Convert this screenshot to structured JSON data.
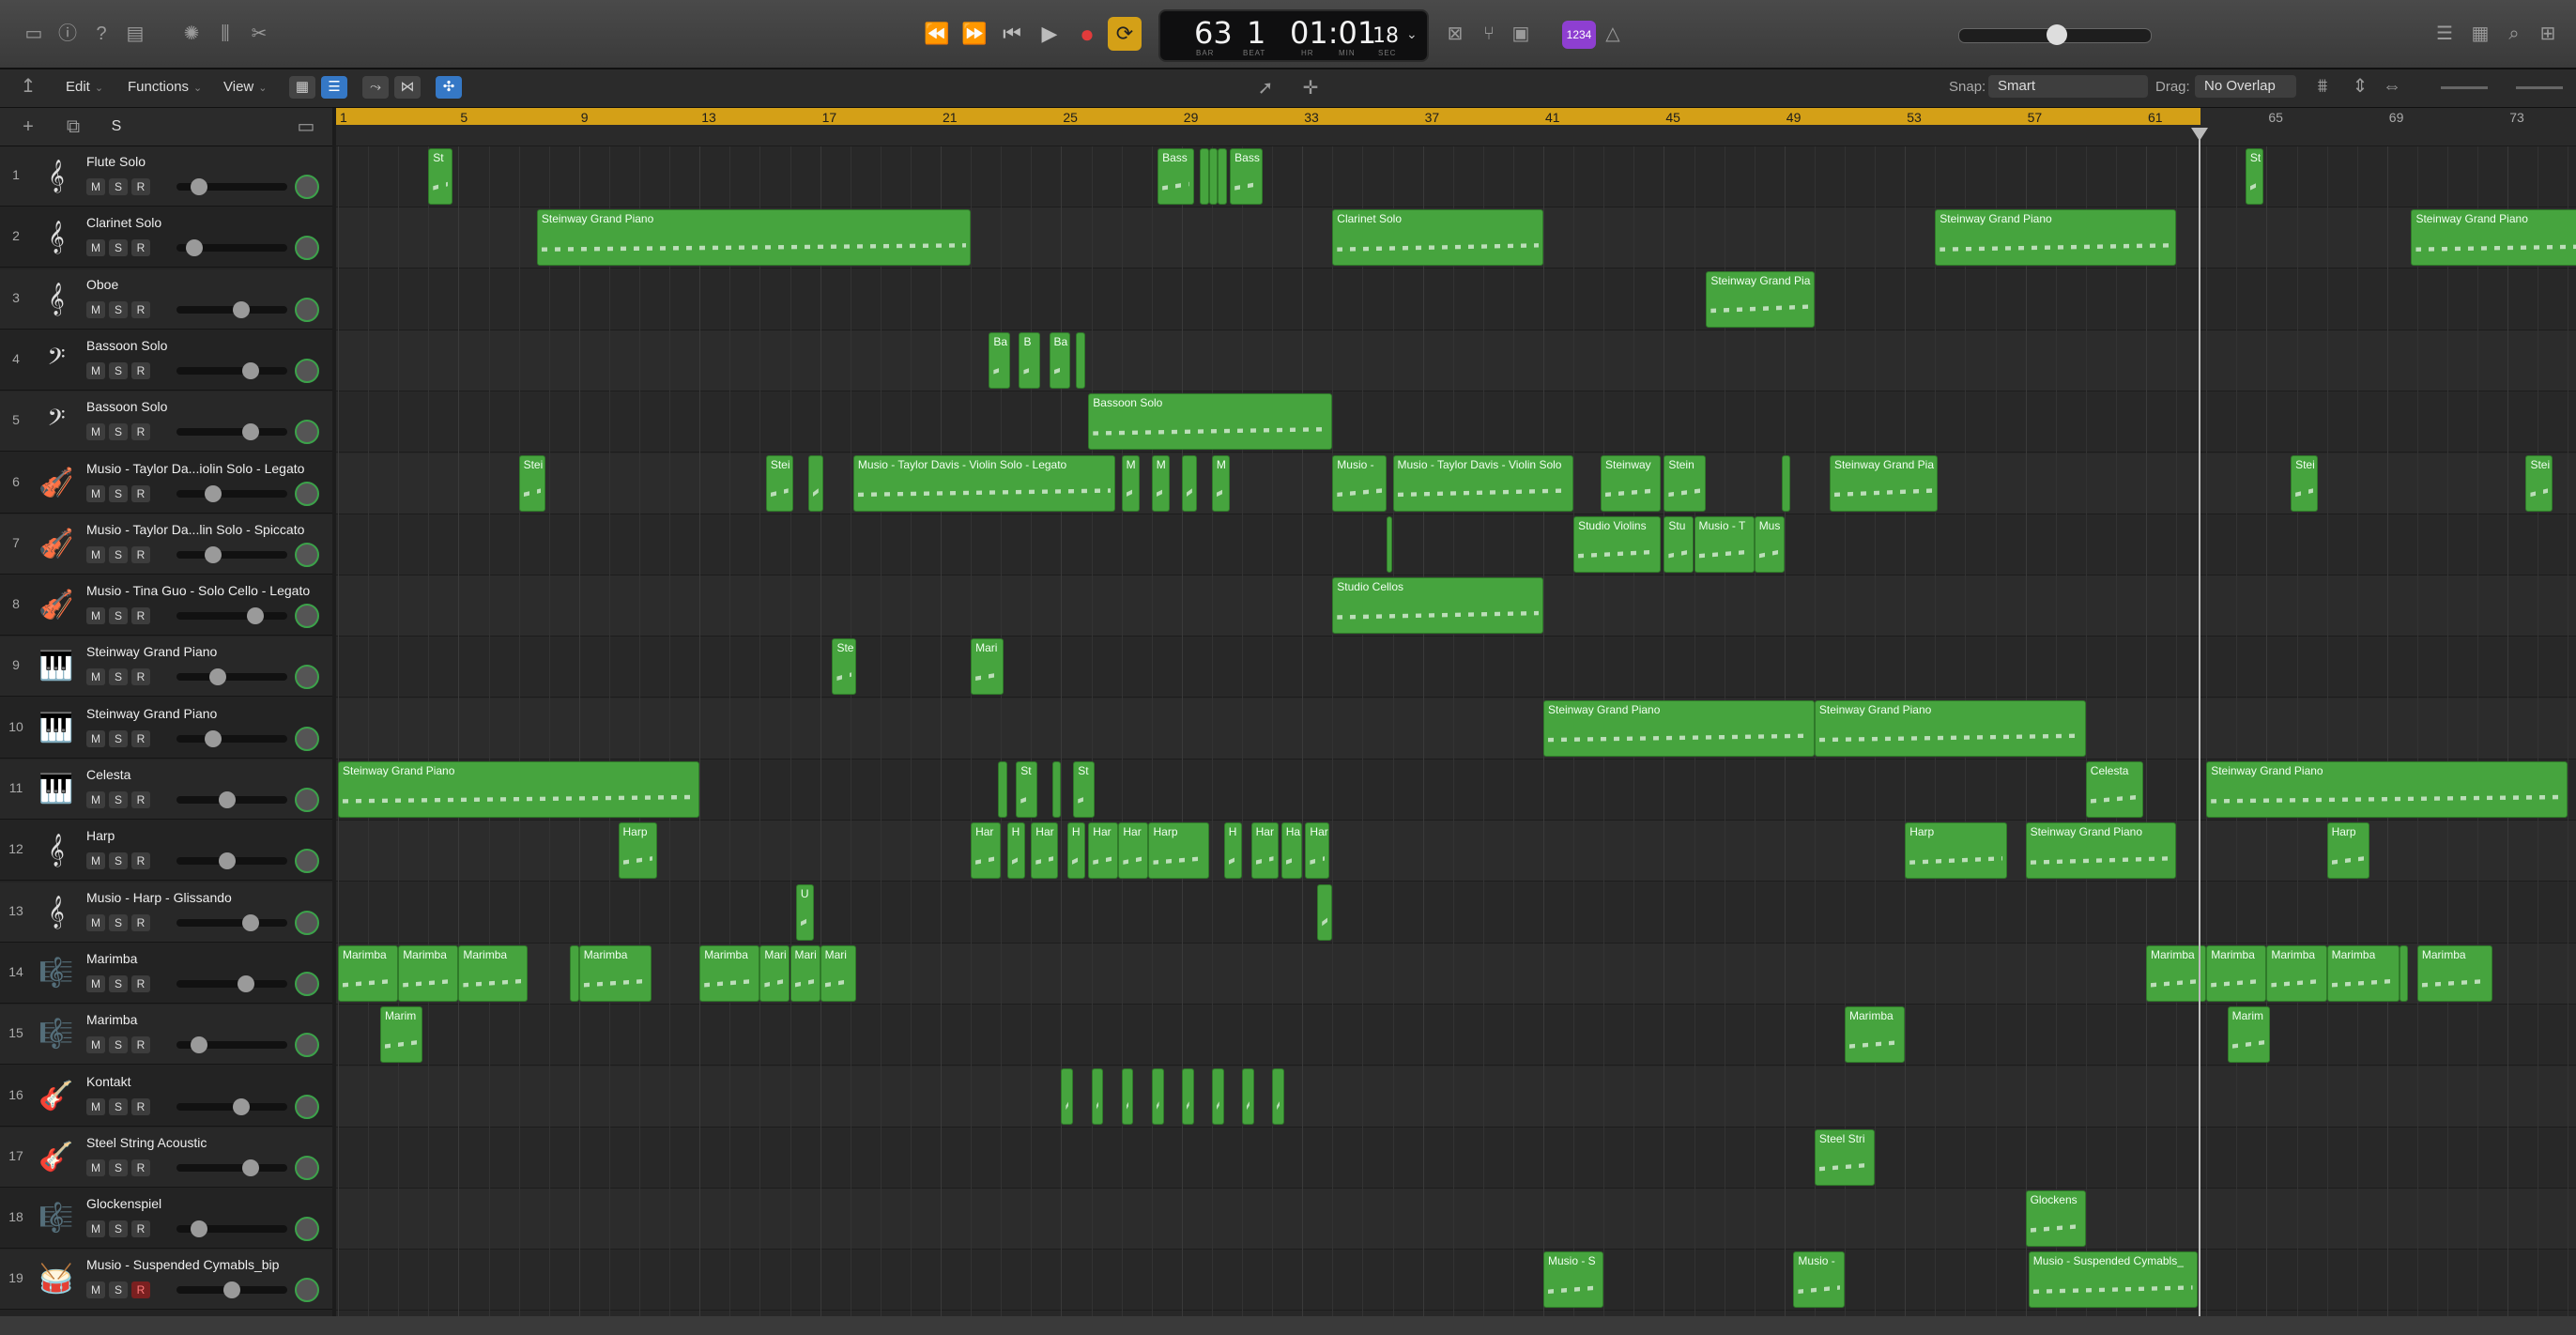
{
  "control_bar": {
    "lcd": {
      "bar": "63",
      "beat": "1",
      "time": "01:01",
      "frames": "18",
      "bar_label": "BAR",
      "beat_label": "BEAT",
      "hr_label": "HR",
      "min_label": "MIN",
      "sec_label": "SEC"
    },
    "badge": "1234"
  },
  "toolbar": {
    "edit": "Edit",
    "functions": "Functions",
    "view": "View",
    "snap_label": "Snap:",
    "snap_value": "Smart",
    "drag_label": "Drag:",
    "drag_value": "No Overlap"
  },
  "track_header": {
    "solo_label": "S"
  },
  "ruler": [
    "1",
    "5",
    "9",
    "13",
    "17",
    "21",
    "25",
    "29",
    "33",
    "37",
    "41",
    "45",
    "49",
    "53",
    "57",
    "61",
    "65",
    "69",
    "73"
  ],
  "tracks": [
    {
      "num": "1",
      "name": "Flute Solo",
      "icon": "flute-icon",
      "glyph": "𝄞",
      "vol": 0.15,
      "m": "M",
      "s": "S",
      "r": "R"
    },
    {
      "num": "2",
      "name": "Clarinet Solo",
      "icon": "clarinet-icon",
      "glyph": "𝄞",
      "vol": 0.1,
      "m": "M",
      "s": "S",
      "r": "R"
    },
    {
      "num": "3",
      "name": "Oboe",
      "icon": "oboe-icon",
      "glyph": "𝄞",
      "vol": 0.6,
      "m": "M",
      "s": "S",
      "r": "R"
    },
    {
      "num": "4",
      "name": "Bassoon Solo",
      "icon": "bassoon-icon",
      "glyph": "𝄢",
      "vol": 0.7,
      "m": "M",
      "s": "S",
      "r": "R"
    },
    {
      "num": "5",
      "name": "Bassoon Solo",
      "icon": "bassoon-icon",
      "glyph": "𝄢",
      "vol": 0.7,
      "m": "M",
      "s": "S",
      "r": "R"
    },
    {
      "num": "6",
      "name": "Musio - Taylor Da...iolin Solo - Legato",
      "icon": "violin-icon",
      "glyph": "🎻",
      "vol": 0.3,
      "m": "M",
      "s": "S",
      "r": "R"
    },
    {
      "num": "7",
      "name": "Musio - Taylor Da...lin Solo - Spiccato",
      "icon": "violin-icon",
      "glyph": "🎻",
      "vol": 0.3,
      "m": "M",
      "s": "S",
      "r": "R"
    },
    {
      "num": "8",
      "name": "Musio - Tina Guo - Solo Cello - Legato",
      "icon": "cello-icon",
      "glyph": "🎻",
      "vol": 0.75,
      "m": "M",
      "s": "S",
      "r": "R"
    },
    {
      "num": "9",
      "name": "Steinway Grand Piano",
      "icon": "piano-icon",
      "glyph": "🎹",
      "vol": 0.35,
      "m": "M",
      "s": "S",
      "r": "R"
    },
    {
      "num": "10",
      "name": "Steinway Grand Piano",
      "icon": "piano-icon",
      "glyph": "🎹",
      "vol": 0.3,
      "m": "M",
      "s": "S",
      "r": "R"
    },
    {
      "num": "11",
      "name": "Celesta",
      "icon": "celesta-icon",
      "glyph": "🎹",
      "vol": 0.45,
      "m": "M",
      "s": "S",
      "r": "R"
    },
    {
      "num": "12",
      "name": "Harp",
      "icon": "harp-icon",
      "glyph": "𝄞",
      "vol": 0.45,
      "m": "M",
      "s": "S",
      "r": "R"
    },
    {
      "num": "13",
      "name": "Musio - Harp - Glissando",
      "icon": "harp-icon",
      "glyph": "𝄞",
      "vol": 0.7,
      "m": "M",
      "s": "S",
      "r": "R"
    },
    {
      "num": "14",
      "name": "Marimba",
      "icon": "marimba-icon",
      "glyph": "🎼",
      "vol": 0.65,
      "m": "M",
      "s": "S",
      "r": "R"
    },
    {
      "num": "15",
      "name": "Marimba",
      "icon": "marimba-icon",
      "glyph": "🎼",
      "vol": 0.15,
      "m": "M",
      "s": "S",
      "r": "R"
    },
    {
      "num": "16",
      "name": "Kontakt",
      "icon": "guitar-icon",
      "glyph": "🎸",
      "vol": 0.6,
      "m": "M",
      "s": "S",
      "r": "R"
    },
    {
      "num": "17",
      "name": "Steel String Acoustic",
      "icon": "guitar-icon",
      "glyph": "🎸",
      "vol": 0.7,
      "m": "M",
      "s": "S",
      "r": "R"
    },
    {
      "num": "18",
      "name": "Glockenspiel",
      "icon": "glockenspiel-icon",
      "glyph": "🎼",
      "vol": 0.15,
      "m": "M",
      "s": "S",
      "r": "R"
    },
    {
      "num": "19",
      "name": "Musio - Suspended Cymabls_bip",
      "icon": "cymbal-icon",
      "glyph": "🥁",
      "vol": 0.5,
      "m": "M",
      "s": "S",
      "r": "R",
      "armed": true
    }
  ],
  "regions": [
    {
      "track": 0,
      "start": 4.0,
      "len": 0.8,
      "label": "St"
    },
    {
      "track": 0,
      "start": 28.2,
      "len": 1.2,
      "label": "Bass"
    },
    {
      "track": 0,
      "start": 29.6,
      "len": 0.3,
      "label": ""
    },
    {
      "track": 0,
      "start": 29.9,
      "len": 0.3,
      "label": ""
    },
    {
      "track": 0,
      "start": 30.2,
      "len": 0.3,
      "label": ""
    },
    {
      "track": 0,
      "start": 30.6,
      "len": 1.1,
      "label": "Bass"
    },
    {
      "track": 0,
      "start": 64.3,
      "len": 0.6,
      "label": "St"
    },
    {
      "track": 1,
      "start": 7.6,
      "len": 14.4,
      "label": "Steinway Grand Piano"
    },
    {
      "track": 1,
      "start": 34.0,
      "len": 7.0,
      "label": "Clarinet Solo"
    },
    {
      "track": 1,
      "start": 54.0,
      "len": 8.0,
      "label": "Steinway Grand Piano"
    },
    {
      "track": 1,
      "start": 69.8,
      "len": 8.3,
      "label": "Steinway Grand Piano"
    },
    {
      "track": 2,
      "start": 46.4,
      "len": 3.6,
      "label": "Steinway Grand Pia"
    },
    {
      "track": 3,
      "start": 22.6,
      "len": 0.7,
      "label": "Ba"
    },
    {
      "track": 3,
      "start": 23.6,
      "len": 0.7,
      "label": "B"
    },
    {
      "track": 3,
      "start": 24.6,
      "len": 0.7,
      "label": "Ba"
    },
    {
      "track": 3,
      "start": 25.5,
      "len": 0.3,
      "label": ""
    },
    {
      "track": 4,
      "start": 25.9,
      "len": 8.1,
      "label": "Bassoon Solo"
    },
    {
      "track": 5,
      "start": 7.0,
      "len": 0.9,
      "label": "Stei"
    },
    {
      "track": 5,
      "start": 15.2,
      "len": 0.9,
      "label": "Stei"
    },
    {
      "track": 5,
      "start": 16.6,
      "len": 0.5,
      "label": ""
    },
    {
      "track": 5,
      "start": 18.1,
      "len": 8.7,
      "label": "Musio - Taylor Davis - Violin Solo - Legato"
    },
    {
      "track": 5,
      "start": 27.0,
      "len": 0.6,
      "label": "M"
    },
    {
      "track": 5,
      "start": 28.0,
      "len": 0.6,
      "label": "M"
    },
    {
      "track": 5,
      "start": 29.0,
      "len": 0.5,
      "label": ""
    },
    {
      "track": 5,
      "start": 30.0,
      "len": 0.6,
      "label": "M"
    },
    {
      "track": 5,
      "start": 34.0,
      "len": 1.8,
      "label": "Musio -"
    },
    {
      "track": 5,
      "start": 36.0,
      "len": 6.0,
      "label": "Musio - Taylor Davis - Violin Solo"
    },
    {
      "track": 5,
      "start": 42.9,
      "len": 2.0,
      "label": "Steinway"
    },
    {
      "track": 5,
      "start": 45.0,
      "len": 1.4,
      "label": "Stein"
    },
    {
      "track": 5,
      "start": 48.9,
      "len": 0.3,
      "label": ""
    },
    {
      "track": 5,
      "start": 50.5,
      "len": 3.6,
      "label": "Steinway Grand Pia"
    },
    {
      "track": 5,
      "start": 65.8,
      "len": 0.9,
      "label": "Stei"
    },
    {
      "track": 5,
      "start": 73.6,
      "len": 0.9,
      "label": "Stei"
    },
    {
      "track": 6,
      "start": 35.8,
      "len": 0.2,
      "label": ""
    },
    {
      "track": 6,
      "start": 42.0,
      "len": 2.9,
      "label": "Studio Violins"
    },
    {
      "track": 6,
      "start": 45.0,
      "len": 1.0,
      "label": "Stu"
    },
    {
      "track": 6,
      "start": 46.0,
      "len": 2.0,
      "label": "Musio - T"
    },
    {
      "track": 6,
      "start": 48.0,
      "len": 1.0,
      "label": "Mus"
    },
    {
      "track": 7,
      "start": 34.0,
      "len": 7.0,
      "label": "Studio Cellos"
    },
    {
      "track": 8,
      "start": 17.4,
      "len": 0.8,
      "label": "Ste"
    },
    {
      "track": 8,
      "start": 22.0,
      "len": 1.1,
      "label": "Mari"
    },
    {
      "track": 9,
      "start": 41.0,
      "len": 9.0,
      "label": "Steinway Grand Piano"
    },
    {
      "track": 9,
      "start": 50.0,
      "len": 9.0,
      "label": "Steinway Grand Piano"
    },
    {
      "track": 10,
      "start": 1.0,
      "len": 12.0,
      "label": "Steinway Grand Piano"
    },
    {
      "track": 10,
      "start": 22.9,
      "len": 0.3,
      "label": ""
    },
    {
      "track": 10,
      "start": 23.5,
      "len": 0.7,
      "label": "St"
    },
    {
      "track": 10,
      "start": 24.7,
      "len": 0.3,
      "label": ""
    },
    {
      "track": 10,
      "start": 25.4,
      "len": 0.7,
      "label": "St"
    },
    {
      "track": 10,
      "start": 59.0,
      "len": 1.9,
      "label": "Celesta"
    },
    {
      "track": 10,
      "start": 63.0,
      "len": 12.0,
      "label": "Steinway Grand Piano"
    },
    {
      "track": 11,
      "start": 10.3,
      "len": 1.3,
      "label": "Harp"
    },
    {
      "track": 11,
      "start": 22.0,
      "len": 1.0,
      "label": "Har"
    },
    {
      "track": 11,
      "start": 23.2,
      "len": 0.6,
      "label": "H"
    },
    {
      "track": 11,
      "start": 24.0,
      "len": 0.9,
      "label": "Har"
    },
    {
      "track": 11,
      "start": 25.2,
      "len": 0.6,
      "label": "H"
    },
    {
      "track": 11,
      "start": 25.9,
      "len": 1.0,
      "label": "Har"
    },
    {
      "track": 11,
      "start": 26.9,
      "len": 1.0,
      "label": "Har"
    },
    {
      "track": 11,
      "start": 27.9,
      "len": 2.0,
      "label": "Harp"
    },
    {
      "track": 11,
      "start": 30.4,
      "len": 0.6,
      "label": "H"
    },
    {
      "track": 11,
      "start": 31.3,
      "len": 0.9,
      "label": "Har"
    },
    {
      "track": 11,
      "start": 32.3,
      "len": 0.7,
      "label": "Ha"
    },
    {
      "track": 11,
      "start": 33.1,
      "len": 0.8,
      "label": "Har"
    },
    {
      "track": 11,
      "start": 53.0,
      "len": 3.4,
      "label": "Harp"
    },
    {
      "track": 11,
      "start": 57.0,
      "len": 5.0,
      "label": "Steinway Grand Piano"
    },
    {
      "track": 11,
      "start": 67.0,
      "len": 1.4,
      "label": "Harp"
    },
    {
      "track": 12,
      "start": 16.2,
      "len": 0.6,
      "label": "U"
    },
    {
      "track": 12,
      "start": 33.5,
      "len": 0.5,
      "label": ""
    },
    {
      "track": 13,
      "start": 1.0,
      "len": 2.0,
      "label": "Marimba"
    },
    {
      "track": 13,
      "start": 3.0,
      "len": 2.0,
      "label": "Marimba"
    },
    {
      "track": 13,
      "start": 5.0,
      "len": 2.3,
      "label": "Marimba"
    },
    {
      "track": 13,
      "start": 8.7,
      "len": 0.3,
      "label": ""
    },
    {
      "track": 13,
      "start": 9.0,
      "len": 2.4,
      "label": "Marimba"
    },
    {
      "track": 13,
      "start": 13.0,
      "len": 2.0,
      "label": "Marimba"
    },
    {
      "track": 13,
      "start": 15.0,
      "len": 1.0,
      "label": "Mari"
    },
    {
      "track": 13,
      "start": 16.0,
      "len": 1.0,
      "label": "Mari"
    },
    {
      "track": 13,
      "start": 17.0,
      "len": 1.2,
      "label": "Mari"
    },
    {
      "track": 13,
      "start": 61.0,
      "len": 2.0,
      "label": "Marimba"
    },
    {
      "track": 13,
      "start": 63.0,
      "len": 2.0,
      "label": "Marimba"
    },
    {
      "track": 13,
      "start": 65.0,
      "len": 2.0,
      "label": "Marimba"
    },
    {
      "track": 13,
      "start": 67.0,
      "len": 2.4,
      "label": "Marimba"
    },
    {
      "track": 13,
      "start": 69.4,
      "len": 0.3,
      "label": ""
    },
    {
      "track": 13,
      "start": 70.0,
      "len": 2.5,
      "label": "Marimba"
    },
    {
      "track": 14,
      "start": 2.4,
      "len": 1.4,
      "label": "Marim"
    },
    {
      "track": 14,
      "start": 51.0,
      "len": 2.0,
      "label": "Marimba"
    },
    {
      "track": 14,
      "start": 63.7,
      "len": 1.4,
      "label": "Marim"
    },
    {
      "track": 15,
      "start": 25.0,
      "len": 0.4,
      "label": ""
    },
    {
      "track": 15,
      "start": 26.0,
      "len": 0.4,
      "label": ""
    },
    {
      "track": 15,
      "start": 27.0,
      "len": 0.4,
      "label": ""
    },
    {
      "track": 15,
      "start": 28.0,
      "len": 0.4,
      "label": ""
    },
    {
      "track": 15,
      "start": 29.0,
      "len": 0.4,
      "label": ""
    },
    {
      "track": 15,
      "start": 30.0,
      "len": 0.4,
      "label": ""
    },
    {
      "track": 15,
      "start": 31.0,
      "len": 0.4,
      "label": ""
    },
    {
      "track": 15,
      "start": 32.0,
      "len": 0.4,
      "label": ""
    },
    {
      "track": 16,
      "start": 50.0,
      "len": 2.0,
      "label": "Steel Stri"
    },
    {
      "track": 17,
      "start": 57.0,
      "len": 2.0,
      "label": "Glockens"
    },
    {
      "track": 18,
      "start": 41.0,
      "len": 2.0,
      "label": "Musio - S"
    },
    {
      "track": 18,
      "start": 49.3,
      "len": 1.7,
      "label": "Musio -"
    },
    {
      "track": 18,
      "start": 57.1,
      "len": 5.6,
      "label": "Musio - Suspended Cymabls_"
    }
  ]
}
